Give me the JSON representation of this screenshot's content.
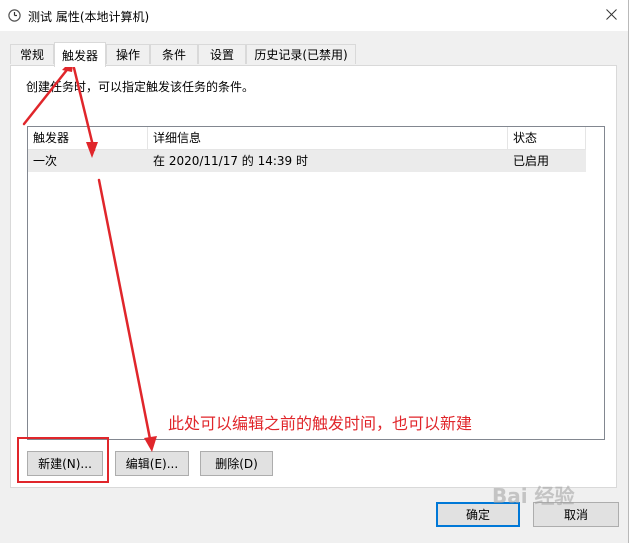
{
  "window": {
    "title": "测试 属性(本地计算机)"
  },
  "tabs": [
    {
      "label": "常规"
    },
    {
      "label": "触发器"
    },
    {
      "label": "操作"
    },
    {
      "label": "条件"
    },
    {
      "label": "设置"
    },
    {
      "label": "历史记录(已禁用)"
    }
  ],
  "active_tab": "触发器",
  "panel": {
    "description": "创建任务时，可以指定触发该任务的条件。"
  },
  "trigger_list": {
    "columns": [
      "触发器",
      "详细信息",
      "状态"
    ],
    "rows": [
      {
        "trigger": "一次",
        "details": "在 2020/11/17 的 14:39 时",
        "status": "已启用"
      }
    ]
  },
  "buttons": {
    "new_label": "新建(N)...",
    "edit_label": "编辑(E)...",
    "delete_label": "删除(D)",
    "ok_label": "确定",
    "cancel_label": "取消"
  },
  "annotation": {
    "text": "此处可以编辑之前的触发时间，也可以新建",
    "color": "#e0262b"
  },
  "watermark": {
    "text": "Bai 经验"
  }
}
